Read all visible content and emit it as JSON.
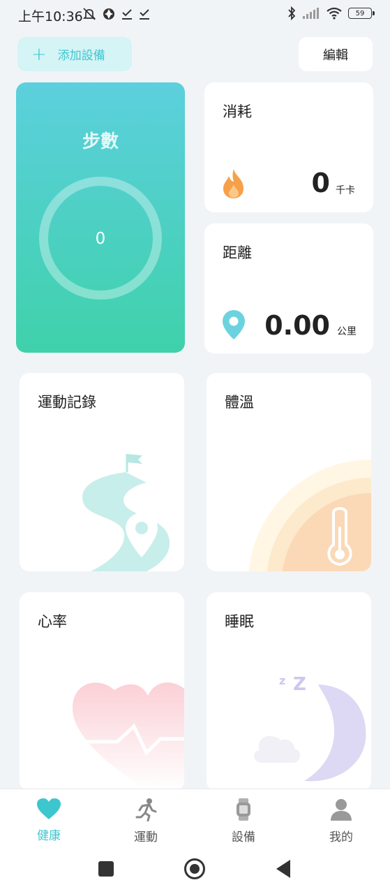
{
  "status_bar": {
    "time": "上午10:36",
    "battery": "59",
    "icons": [
      "mute-icon",
      "aperture-icon",
      "check-download-icon",
      "check-download-icon",
      "bluetooth-icon",
      "signal-icon",
      "wifi-icon",
      "battery-icon"
    ]
  },
  "header": {
    "add_device_plus": "+",
    "add_device_label": "添加設備",
    "edit_label": "編輯"
  },
  "steps": {
    "title": "步數",
    "value": "0"
  },
  "calories": {
    "title": "消耗",
    "value": "0",
    "unit": "千卡",
    "icon": "flame-icon"
  },
  "distance": {
    "title": "距離",
    "value": "0.00",
    "unit": "公里",
    "icon": "location-pin-icon"
  },
  "cards": {
    "exercise_record": "運動記錄",
    "body_temp": "體溫",
    "heart_rate": "心率",
    "sleep": "睡眠"
  },
  "tabs": [
    {
      "label": "健康",
      "icon": "heart-icon",
      "active": true
    },
    {
      "label": "運動",
      "icon": "running-icon",
      "active": false
    },
    {
      "label": "設備",
      "icon": "watch-icon",
      "active": false
    },
    {
      "label": "我的",
      "icon": "user-icon",
      "active": false
    }
  ],
  "colors": {
    "accent": "#3ec6cf",
    "steps_gradient_top": "#5cd0dd",
    "steps_gradient_bottom": "#3fd1ab",
    "flame": "#f7a04a",
    "pin": "#6bd3de"
  }
}
